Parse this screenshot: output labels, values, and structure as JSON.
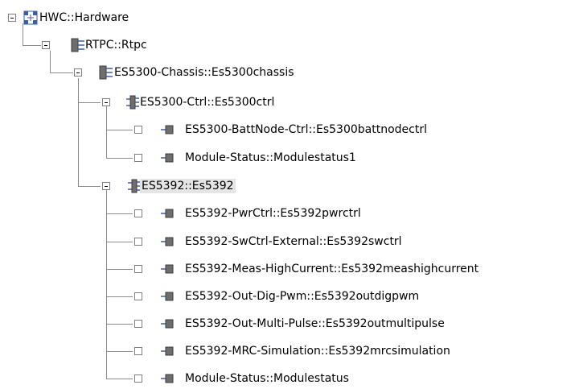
{
  "tree": {
    "nodes": [
      {
        "label": "HWC::Hardware",
        "icon": "hardware-root-icon",
        "expanded": true,
        "checkbox": false
      },
      {
        "label": "RTPC::Rtpc",
        "icon": "rtpc-node-icon",
        "expanded": true,
        "checkbox": false
      },
      {
        "label": "ES5300-Chassis::Es5300chassis",
        "icon": "chassis-node-icon",
        "expanded": true,
        "checkbox": false
      },
      {
        "label": "ES5300-Ctrl::Es5300ctrl",
        "icon": "controller-node-icon",
        "expanded": true,
        "checkbox": false
      },
      {
        "label": "ES5300-BattNode-Ctrl::Es5300battnodectrl",
        "icon": "leaf-module-icon",
        "checkbox": true
      },
      {
        "label": "Module-Status::Modulestatus1",
        "icon": "leaf-module-icon",
        "checkbox": true
      },
      {
        "label": "ES5392::Es5392",
        "icon": "controller-node-icon",
        "expanded": true,
        "checkbox": false,
        "selected": true
      },
      {
        "label": "ES5392-PwrCtrl::Es5392pwrctrl",
        "icon": "leaf-module-icon",
        "checkbox": true
      },
      {
        "label": "ES5392-SwCtrl-External::Es5392swctrl",
        "icon": "leaf-module-icon",
        "checkbox": true
      },
      {
        "label": "ES5392-Meas-HighCurrent::Es5392meashighcurrent",
        "icon": "leaf-module-icon",
        "checkbox": true
      },
      {
        "label": "ES5392-Out-Dig-Pwm::Es5392outdigpwm",
        "icon": "leaf-module-icon",
        "checkbox": true
      },
      {
        "label": "ES5392-Out-Multi-Pulse::Es5392outmultipulse",
        "icon": "leaf-module-icon",
        "checkbox": true
      },
      {
        "label": "ES5392-MRC-Simulation::Es5392mrcsimulation",
        "icon": "leaf-module-icon",
        "checkbox": true
      },
      {
        "label": "Module-Status::Modulestatus",
        "icon": "leaf-module-icon",
        "checkbox": true
      }
    ]
  },
  "colors": {
    "icon_fill": "#6e6e6e",
    "icon_dark": "#3c3c3c",
    "icon_blue": "#3a5fa8",
    "guide_line": "#8c8c8c",
    "selected_background": "#e5e5e5"
  }
}
